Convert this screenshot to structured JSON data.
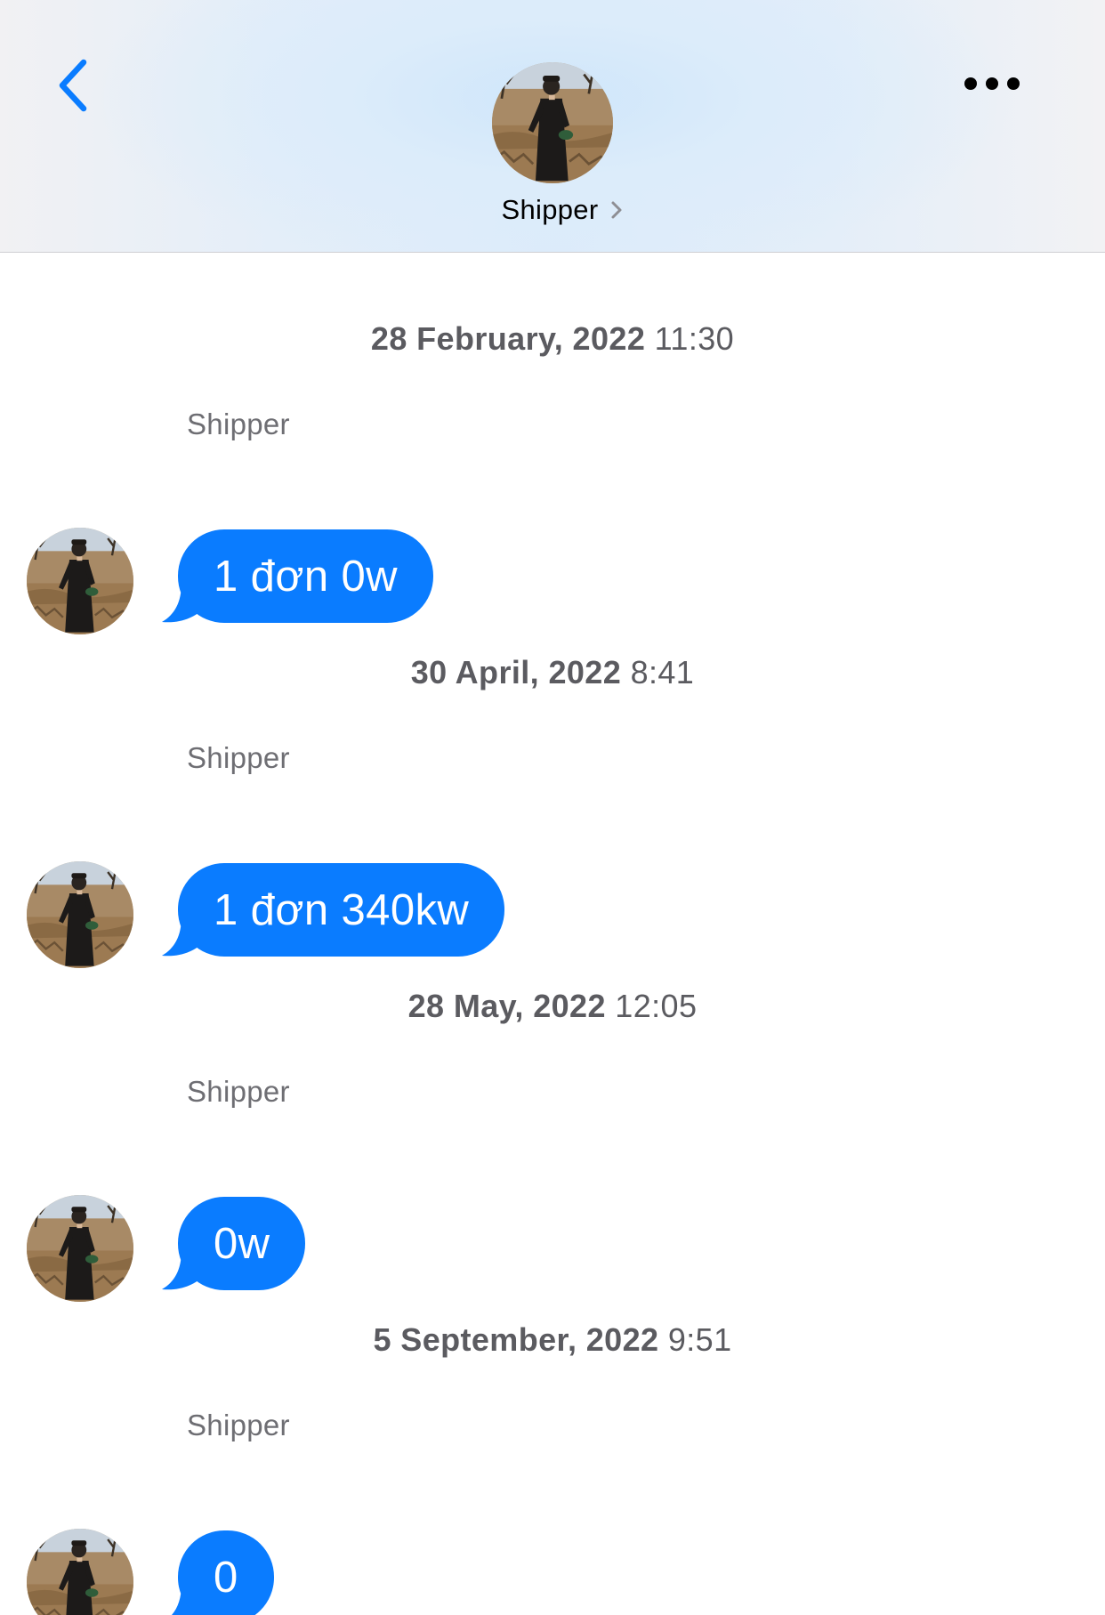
{
  "header": {
    "back_icon": "chevron-left-icon",
    "more_icon": "ellipsis-icon",
    "contact_name": "Shipper",
    "name_chevron_icon": "chevron-right-icon"
  },
  "colors": {
    "accent": "#0a7cff",
    "bubble_text": "#ffffff",
    "timestamp_text": "#5b5b60",
    "sender_text": "#6e6e73"
  },
  "messages": [
    {
      "date": "28 February, 2022",
      "time": "11:30",
      "sender": "Shipper",
      "text": "1 đơn 0w"
    },
    {
      "date": "30 April, 2022",
      "time": "8:41",
      "sender": "Shipper",
      "text": "1 đơn 340kw"
    },
    {
      "date": "28 May, 2022",
      "time": "12:05",
      "sender": "Shipper",
      "text": "0w"
    },
    {
      "date": "5 September, 2022",
      "time": "9:51",
      "sender": "Shipper",
      "text": "0"
    }
  ]
}
